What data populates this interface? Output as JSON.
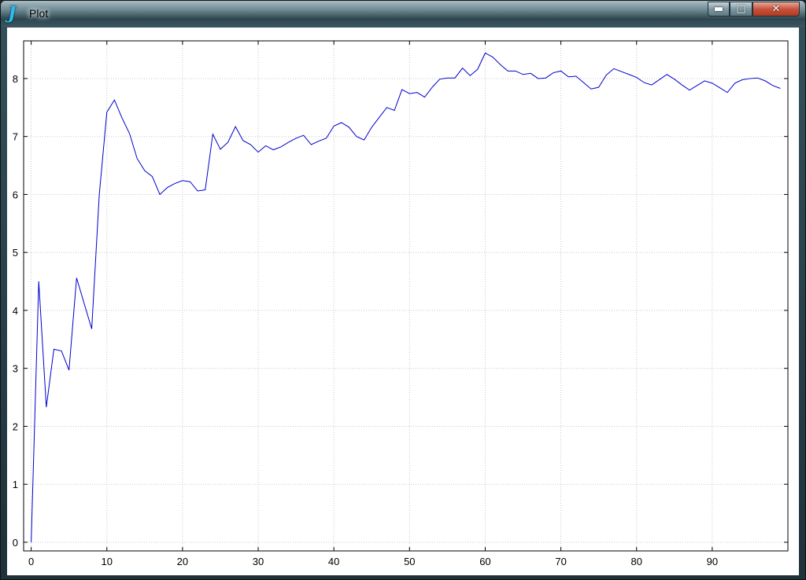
{
  "window": {
    "title": "Plot",
    "app_icon_glyph": "J",
    "controls": {
      "minimize_glyph": "▬",
      "maximize_glyph": "□",
      "close_glyph": "✕"
    }
  },
  "chart_data": {
    "type": "line",
    "title": "",
    "xlabel": "",
    "ylabel": "",
    "xlim": [
      -1,
      100
    ],
    "ylim": [
      -0.15,
      8.65
    ],
    "xticks": [
      0,
      10,
      20,
      30,
      40,
      50,
      60,
      70,
      80,
      90
    ],
    "yticks": [
      0,
      1,
      2,
      3,
      4,
      5,
      6,
      7,
      8
    ],
    "grid": true,
    "line_color": "#0000cc",
    "series": [
      {
        "values": [
          0,
          4.5,
          2.33,
          3.33,
          3.3,
          2.97,
          4.56,
          4.12,
          3.68,
          6.0,
          7.42,
          7.63,
          7.32,
          7.05,
          6.62,
          6.41,
          6.31,
          6.0,
          6.12,
          6.19,
          6.24,
          6.22,
          6.06,
          6.08,
          7.04,
          6.78,
          6.9,
          7.17,
          6.93,
          6.86,
          6.73,
          6.84,
          6.77,
          6.82,
          6.9,
          6.97,
          7.02,
          6.86,
          6.92,
          6.97,
          7.18,
          7.24,
          7.16,
          7.0,
          6.94,
          7.16,
          7.33,
          7.5,
          7.45,
          7.81,
          7.74,
          7.76,
          7.68,
          7.85,
          7.99,
          8.01,
          8.01,
          8.18,
          8.05,
          8.16,
          8.44,
          8.37,
          8.24,
          8.13,
          8.13,
          8.07,
          8.09,
          8.0,
          8.01,
          8.1,
          8.13,
          8.03,
          8.04,
          7.93,
          7.82,
          7.85,
          8.06,
          8.17,
          8.12,
          8.07,
          8.02,
          7.93,
          7.89,
          7.98,
          8.07,
          7.99,
          7.89,
          7.8,
          7.88,
          7.96,
          7.92,
          7.84,
          7.76,
          7.92,
          7.98,
          8.0,
          8.01,
          7.96,
          7.88,
          7.83
        ]
      }
    ]
  }
}
